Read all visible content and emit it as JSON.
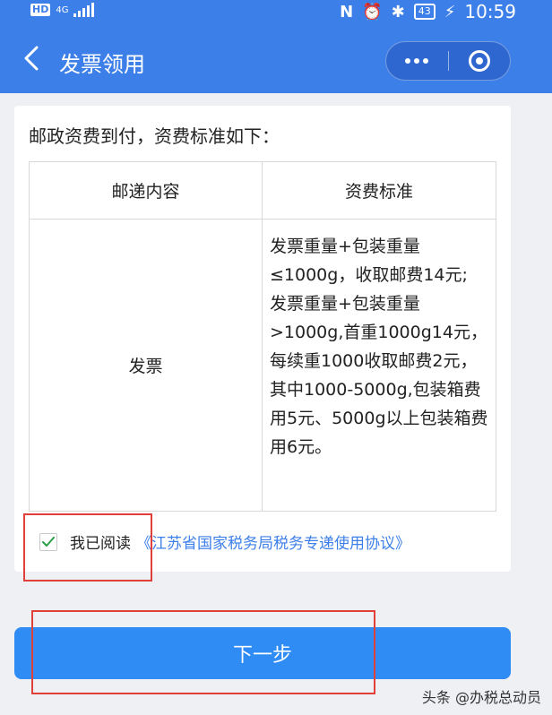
{
  "status_bar": {
    "network": "HD",
    "signal_label": "4G",
    "nfc": "N",
    "battery": "43",
    "time": "10:59"
  },
  "header": {
    "title": "发票领用"
  },
  "content": {
    "intro": "邮政资费到付，资费标准如下：",
    "table": {
      "headers": [
        "邮递内容",
        "资费标准"
      ],
      "rows": [
        {
          "item": "发票",
          "fee": "发票重量+包装重量≤1000g，收取邮费14元; 发票重量+包装重量>1000g,首重1000g14元，每续重1000收取邮费2元，其中1000-5000g,包装箱费用5元、5000g以上包装箱费用6元。"
        }
      ]
    },
    "agreement": {
      "checked": true,
      "text": "我已阅读",
      "link": "《江苏省国家税务局税务专递使用协议》"
    }
  },
  "next_button": {
    "label": "下一步"
  },
  "watermark": "头条 @办税总动员",
  "colors": {
    "header_blue": "#3d7fe8",
    "button_blue": "#2f8cf4",
    "highlight_red": "#e0403a"
  }
}
